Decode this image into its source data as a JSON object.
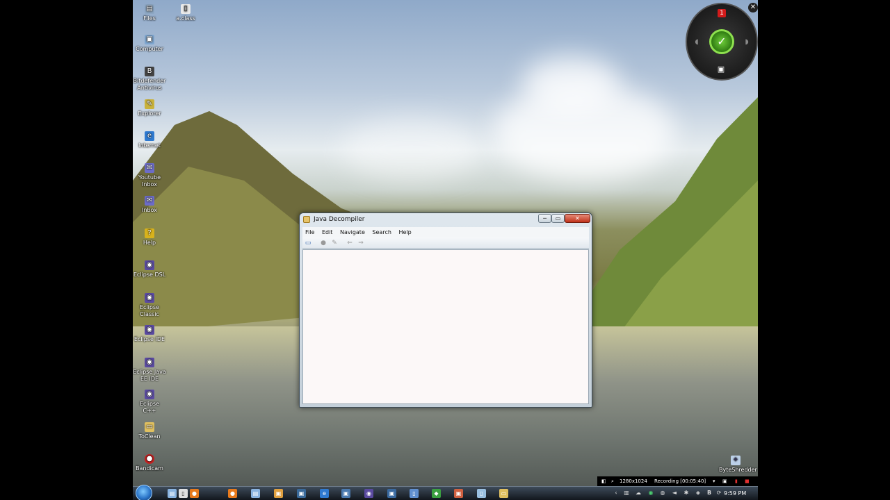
{
  "desktop": {
    "icons": [
      {
        "label": "Files",
        "glyph": "▤",
        "color": "#8ca6c2"
      },
      {
        "label": "a.class",
        "glyph": "▯",
        "color": "#e9e9e9"
      },
      {
        "label": "Computer",
        "glyph": "▣",
        "color": "#7fa7d0"
      },
      {
        "label": "Bitdefender Antivirus",
        "glyph": "B",
        "color": "#444"
      },
      {
        "label": "Explorer",
        "glyph": "✎",
        "color": "#c9b23c"
      },
      {
        "label": "Internet",
        "glyph": "e",
        "color": "#2f7ad0"
      },
      {
        "label": "Youtube Inbox",
        "glyph": "✉",
        "color": "#6c6cc8"
      },
      {
        "label": "Inbox",
        "glyph": "✉",
        "color": "#6c6cc8"
      },
      {
        "label": "Help",
        "glyph": "?",
        "color": "#d8b21c"
      },
      {
        "label": "Eclipse DSL",
        "glyph": "◉",
        "color": "#5a4aa0"
      },
      {
        "label": "Eclipse Classic",
        "glyph": "◉",
        "color": "#5a4aa0"
      },
      {
        "label": "Eclipse IDE",
        "glyph": "◉",
        "color": "#5a4aa0"
      },
      {
        "label": "Eclipse Java EE IDE",
        "glyph": "◉",
        "color": "#5a4aa0"
      },
      {
        "label": "Eclipse C++",
        "glyph": "◉",
        "color": "#5a4aa0"
      },
      {
        "label": "ToClean",
        "glyph": "▭",
        "color": "#e0c060"
      },
      {
        "label": "Bandicam",
        "glyph": "●",
        "color": "#c82020"
      },
      {
        "label": "ByteShredder",
        "glyph": "✦",
        "color": "#bcd0e8"
      }
    ]
  },
  "gadget": {
    "badge": "1",
    "center_icon": "checkmark-icon",
    "close": "✕"
  },
  "window": {
    "title": "Java Decompiler",
    "controls": {
      "minimize": "─",
      "maximize": "▭",
      "close": "✕"
    },
    "menu": [
      "File",
      "Edit",
      "Navigate",
      "Search",
      "Help"
    ]
  },
  "overlay": {
    "resolution": "1280x1024",
    "recording": "Recording [00:05:40]"
  },
  "taskbar": {
    "clock": "9:59 PM",
    "items": [
      {
        "glyph": "▤",
        "color": "#8ab4e0"
      },
      {
        "glyph": "▯",
        "color": "#e0e0e0"
      },
      {
        "glyph": "●",
        "color": "#e87a1c"
      },
      {
        "glyph": "●",
        "color": "#e87a1c"
      },
      {
        "glyph": "▤",
        "color": "#8ab4e0"
      },
      {
        "glyph": "▣",
        "color": "#e0a040"
      },
      {
        "glyph": "▣",
        "color": "#3a6a9a"
      },
      {
        "glyph": "e",
        "color": "#2f7ad0"
      },
      {
        "glyph": "▣",
        "color": "#4a7ab0"
      },
      {
        "glyph": "◉",
        "color": "#5a4aa0"
      },
      {
        "glyph": "▣",
        "color": "#3a6aa0"
      },
      {
        "glyph": "▯",
        "color": "#6090d0"
      },
      {
        "glyph": "◆",
        "color": "#3aa040"
      },
      {
        "glyph": "▣",
        "color": "#d06040"
      },
      {
        "glyph": "▯",
        "color": "#9ac0e0"
      },
      {
        "glyph": "▭",
        "color": "#e0c060"
      }
    ]
  }
}
